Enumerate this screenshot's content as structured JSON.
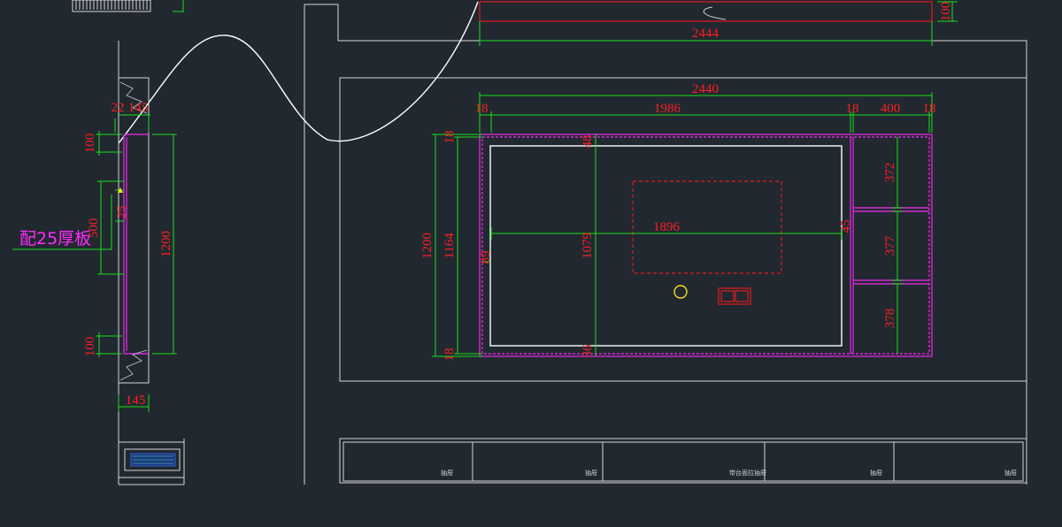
{
  "note": {
    "panel": "配25厚板"
  },
  "dims": {
    "top_2444": "2444",
    "top_100": "100",
    "overall_2440": "2440",
    "seg_18a": "18",
    "seg_1986": "1986",
    "seg_18b": "18",
    "seg_400": "400",
    "seg_18c": "18",
    "h_1200": "1200",
    "h_1164": "1164",
    "h_18a": "18",
    "h_18b": "18",
    "inner_1079": "1079",
    "inner_1896": "1896",
    "inner_48": "48",
    "inner_45": "45",
    "inner_89": "89",
    "inner_36": "36",
    "shelf_372": "372",
    "shelf_377": "377",
    "shelf_378": "378",
    "side_22": "22",
    "side_145_top": "145",
    "side_100_top": "100",
    "side_500": "500",
    "side_25": "25",
    "side_1200": "1200",
    "side_100_bot": "100",
    "side_145_bot": "145"
  },
  "cabinet_labels": [
    "抽屉",
    "抽屉",
    "带台面拉抽屉",
    "抽屉",
    "抽屉"
  ]
}
